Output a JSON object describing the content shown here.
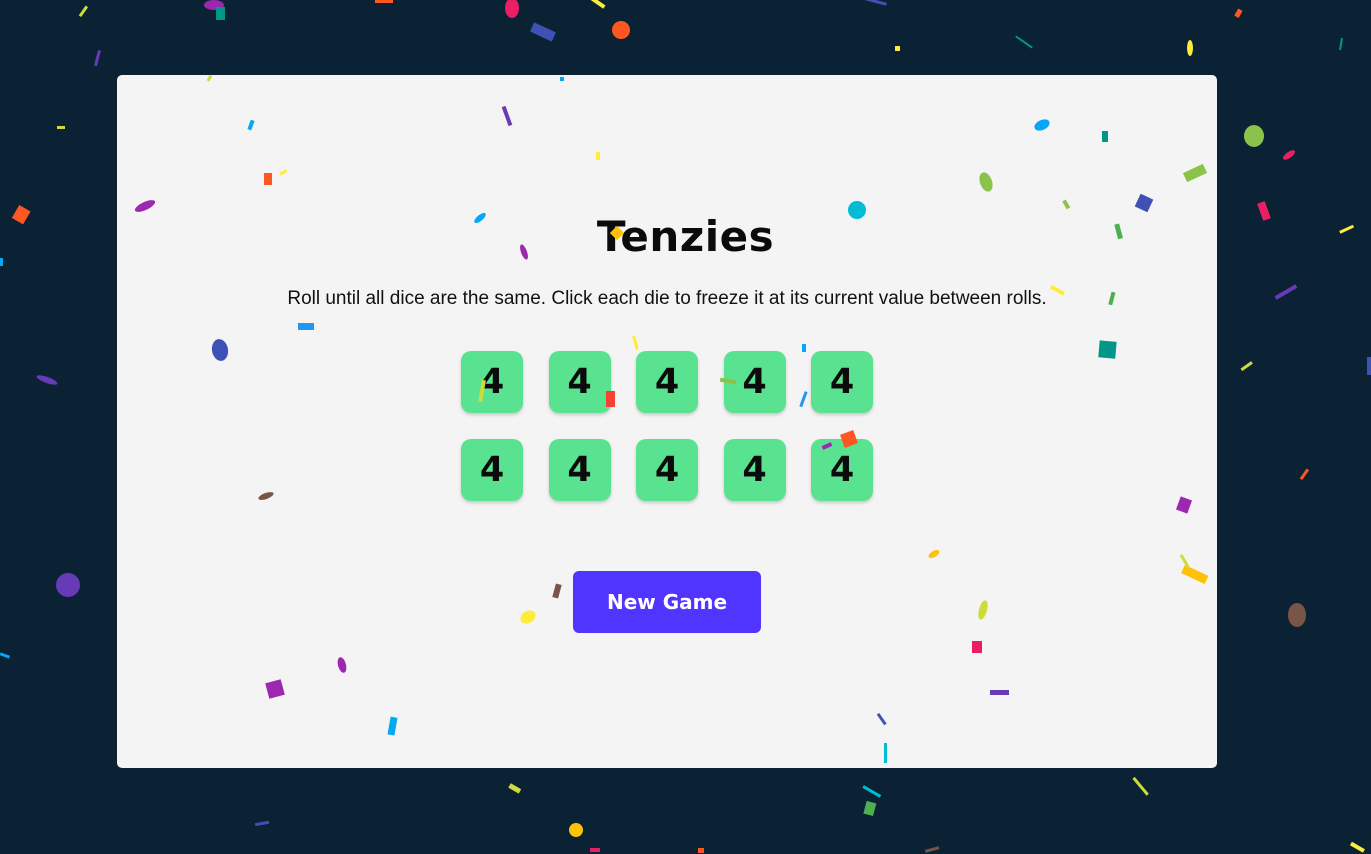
{
  "game": {
    "title": "Tenzies",
    "instructions": "Roll until all dice are the same. Click each die to freeze it at its current value between rolls.",
    "dice": [
      {
        "value": "4"
      },
      {
        "value": "4"
      },
      {
        "value": "4"
      },
      {
        "value": "4"
      },
      {
        "value": "4"
      },
      {
        "value": "4"
      },
      {
        "value": "4"
      },
      {
        "value": "4"
      },
      {
        "value": "4"
      },
      {
        "value": "4"
      }
    ],
    "new_game_label": "New Game"
  },
  "colors": {
    "background": "#0b2234",
    "card": "#f5f4f4",
    "die": "#59e391",
    "button": "#5035ff",
    "button_text": "#ffffff"
  },
  "decorations": {
    "confetti_colors": [
      "#e91e63",
      "#ff5722",
      "#ffc107",
      "#ffeb3b",
      "#cddc39",
      "#8bc34a",
      "#4caf50",
      "#009688",
      "#00bcd4",
      "#03a9f4",
      "#2196f3",
      "#3f51b5",
      "#673ab7",
      "#9c27b0",
      "#795548"
    ]
  }
}
